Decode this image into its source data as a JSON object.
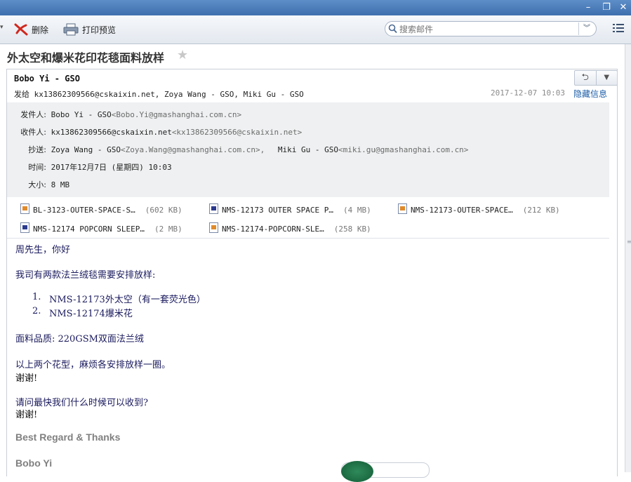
{
  "toolbar": {
    "delete_label": "删除",
    "print_label": "打印预览",
    "search_placeholder": "搜索邮件"
  },
  "message": {
    "subject": "外太空和爆米花印花毯面料放样",
    "sender_name": "Bobo Yi - GSO",
    "send_prefix": "发给",
    "send_recipients": "kx13862309566@cskaixin.net, Zoya Wang - GSO, Miki Gu - GSO",
    "date": "2017-12-07 10:03",
    "hide_info": "隐藏信息"
  },
  "details": {
    "from_label": "发件人:",
    "from_name": "Bobo Yi - GSO",
    "from_addr": "<Bobo.Yi@gmashanghai.com.cn>",
    "to_label": "收件人:",
    "to_name": "kx13862309566@cskaixin.net",
    "to_addr": "<kx13862309566@cskaixin.net>",
    "cc_label": "抄送:",
    "cc1_name": "Zoya Wang - GSO",
    "cc1_addr": "<Zoya.Wang@gmashanghai.com.cn>,",
    "cc2_name": "Miki Gu - GSO",
    "cc2_addr": "<miki.gu@gmashanghai.com.cn>",
    "time_label": "时间:",
    "time_value": "2017年12月7日 (星期四) 10:03",
    "size_label": "大小:",
    "size_value": "8 MB"
  },
  "attachments": [
    {
      "name": "BL-3123-OUTER-SPACE-S…",
      "size": "(602 KB)",
      "icon": "image-file-icon"
    },
    {
      "name": "NMS-12173 OUTER SPACE P…",
      "size": "(4 MB)",
      "icon": "document-file-icon"
    },
    {
      "name": "NMS-12173-OUTER-SPACE…",
      "size": "(212 KB)",
      "icon": "image-file-icon"
    },
    {
      "name": "NMS-12174 POPCORN SLEEP…",
      "size": "(2 MB)",
      "icon": "document-file-icon"
    },
    {
      "name": "NMS-12174-POPCORN-SLE…",
      "size": "(258 KB)",
      "icon": "image-file-icon"
    }
  ],
  "body": {
    "greeting": "周先生，你好",
    "line1": "我司有两款法兰绒毯需要安排放样:",
    "item1_num": "1.",
    "item1": "NMS-12173外太空（有一套荧光色）",
    "item2_num": "2.",
    "item2": "NMS-12174爆米花",
    "fabric": "面料品质: 220GSM双面法兰绒",
    "line2": "以上两个花型，麻烦各安排放样一圈。",
    "thanks1": "谢谢!",
    "line3": "请问最快我们什么时候可以收到?",
    "thanks2": "谢谢!",
    "regards": "Best Regard & Thanks",
    "signature": "Bobo Yi"
  }
}
